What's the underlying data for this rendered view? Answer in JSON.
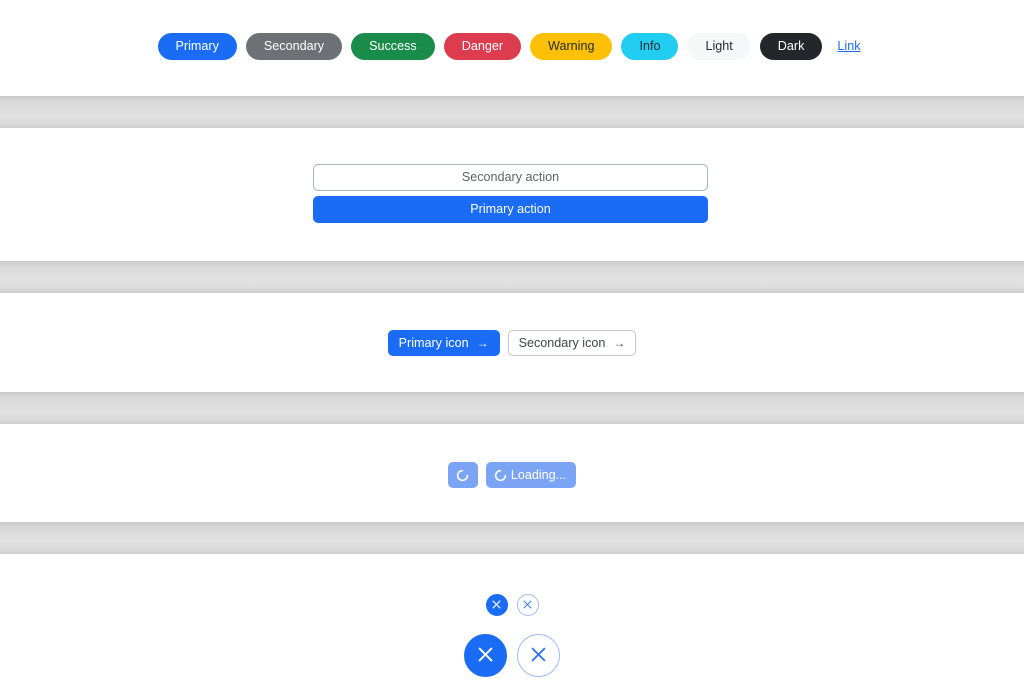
{
  "sections": {
    "contextual_buttons": {
      "buttons": [
        {
          "label": "Primary",
          "variant": "primary",
          "color": "#1a6cf5",
          "text_color": "#ffffff"
        },
        {
          "label": "Secondary",
          "variant": "secondary",
          "color": "#6d7175",
          "text_color": "#ffffff"
        },
        {
          "label": "Success",
          "variant": "success",
          "color": "#1a8c4a",
          "text_color": "#ffffff"
        },
        {
          "label": "Danger",
          "variant": "danger",
          "color": "#dc3c4d",
          "text_color": "#ffffff"
        },
        {
          "label": "Warning",
          "variant": "warning",
          "color": "#fcc106",
          "text_color": "#262b30"
        },
        {
          "label": "Info",
          "variant": "info",
          "color": "#21cdf0",
          "text_color": "#262b30"
        },
        {
          "label": "Light",
          "variant": "light",
          "color": "#f6f7f8",
          "text_color": "#262b30"
        },
        {
          "label": "Dark",
          "variant": "dark",
          "color": "#23272b",
          "text_color": "#ffffff"
        },
        {
          "label": "Link",
          "variant": "link",
          "color": "transparent",
          "text_color": "#1a6cf5"
        }
      ]
    },
    "block_buttons": {
      "secondary_label": "Secondary action",
      "primary_label": "Primary action"
    },
    "icon_buttons": {
      "primary_label": "Primary icon",
      "secondary_label": "Secondary icon",
      "icon": "arrow-right-icon",
      "icon_glyph": "→"
    },
    "loading_buttons": {
      "icon_only_label": "",
      "text_label": "Loading...",
      "spinner_icon": "spinner-icon",
      "disabled_color": "#7ba5f4"
    },
    "close_buttons": {
      "small": [
        {
          "style": "filled",
          "icon": "close-icon"
        },
        {
          "style": "outline",
          "icon": "close-icon"
        }
      ],
      "large": [
        {
          "style": "filled",
          "icon": "close-icon"
        },
        {
          "style": "outline",
          "icon": "close-icon"
        }
      ]
    }
  },
  "theme": {
    "accent": "#1a6cf5",
    "separator_band": "#dedede",
    "background": "#ffffff"
  }
}
